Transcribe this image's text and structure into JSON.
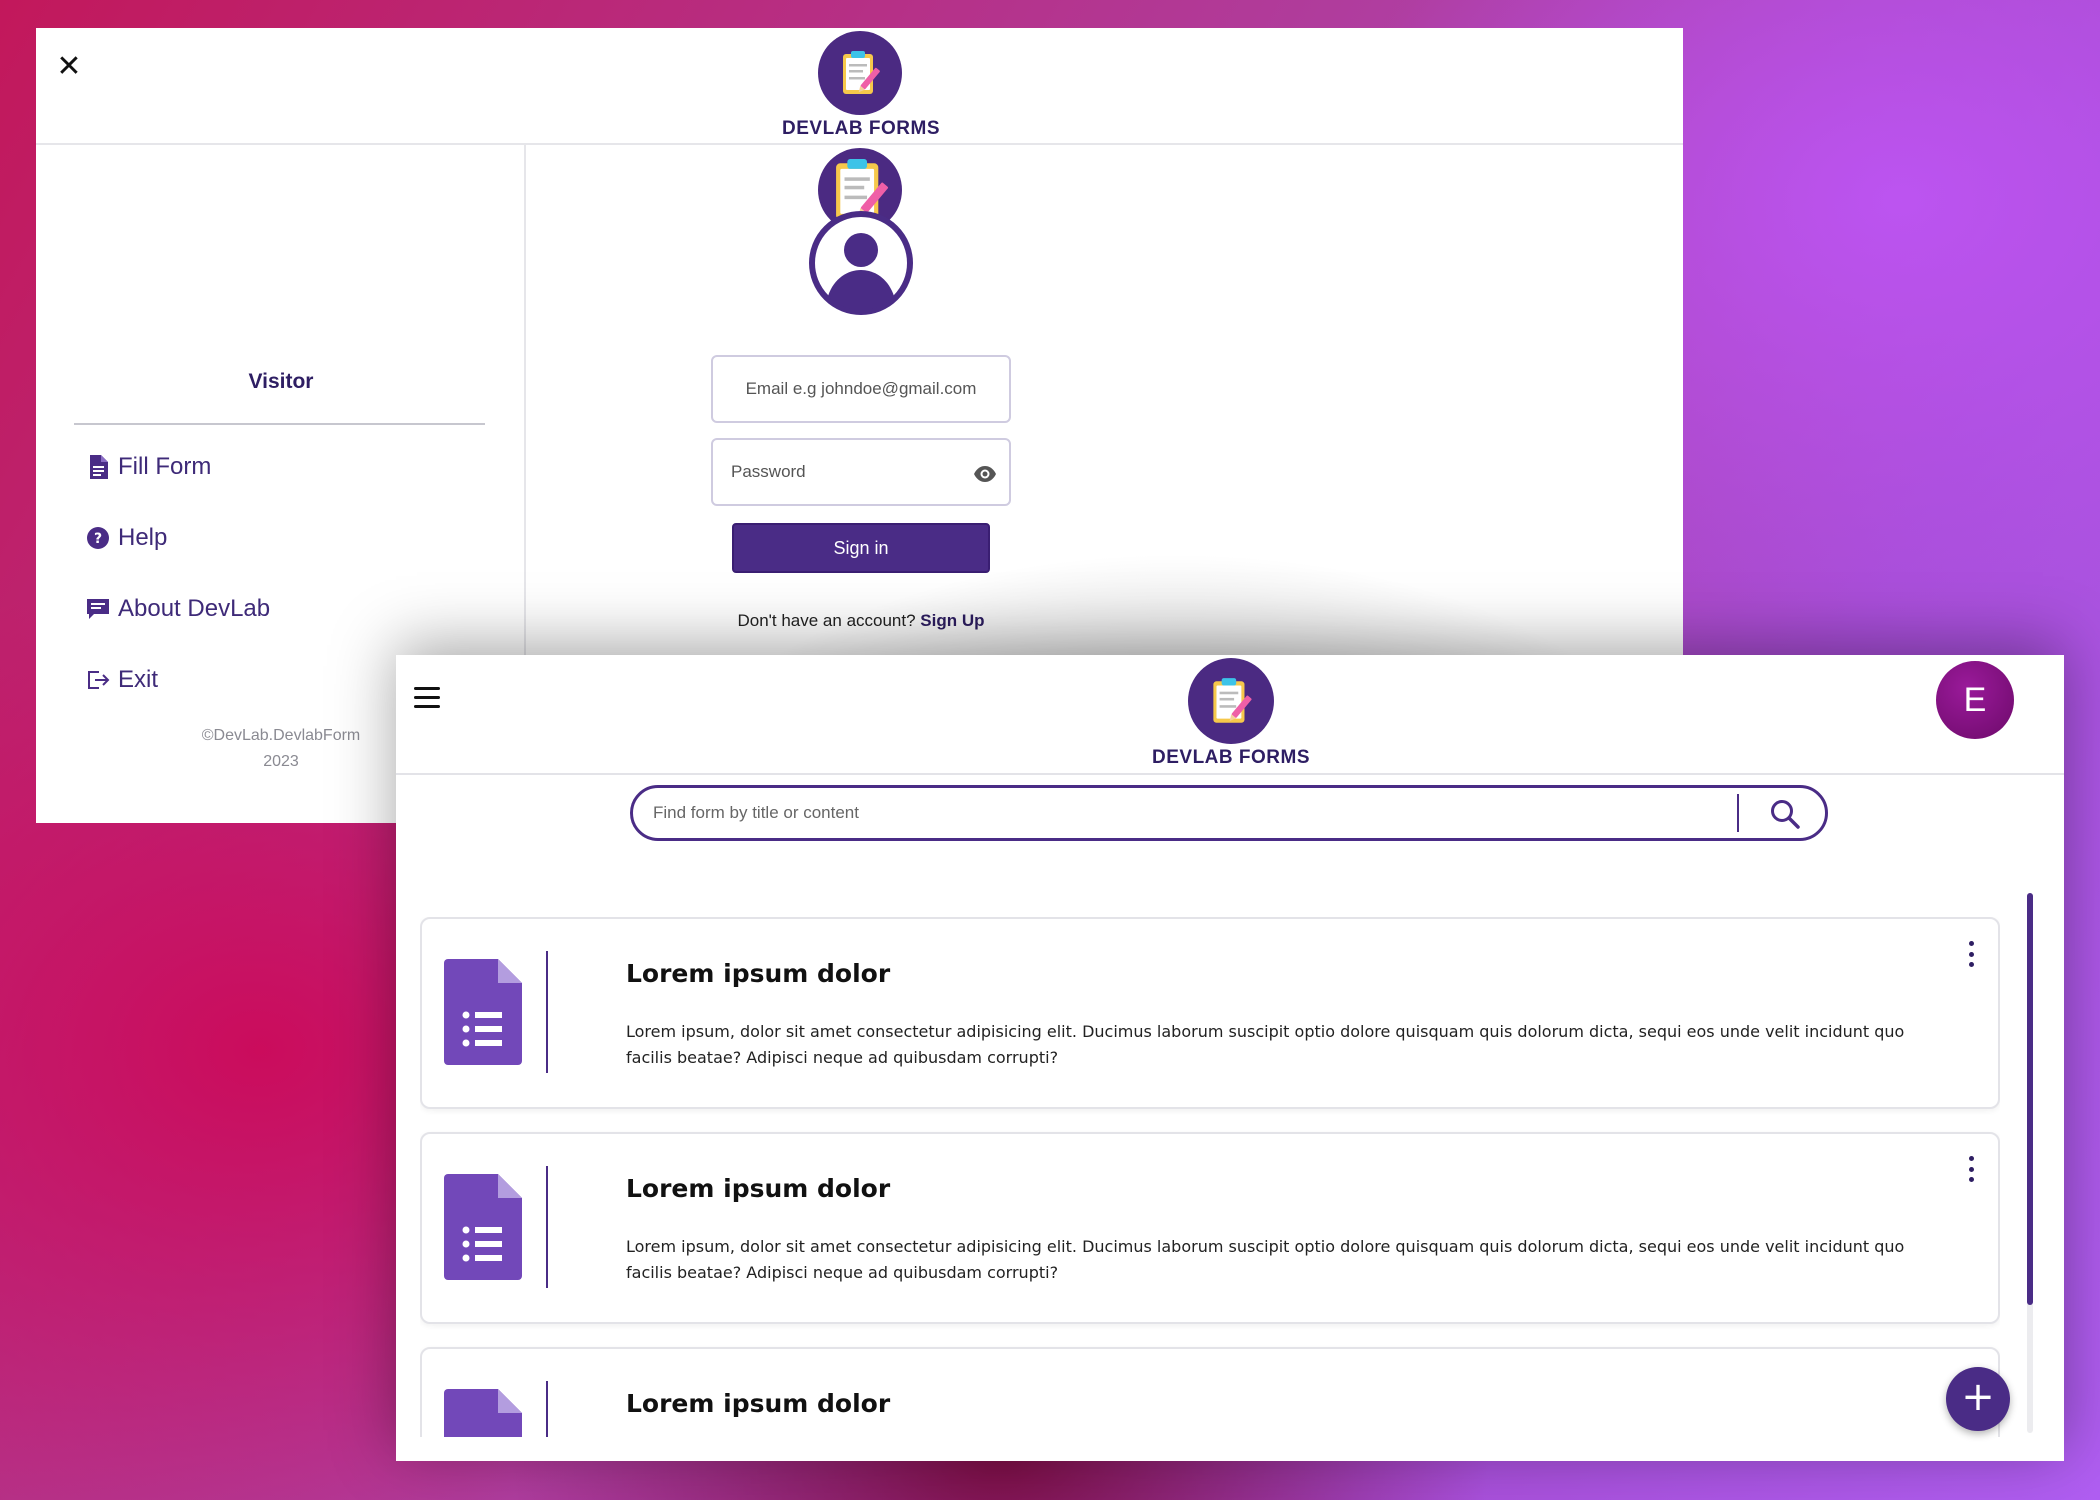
{
  "app": {
    "brand_name": "DEVLAB FORMS"
  },
  "login_window": {
    "close_icon": "close-icon",
    "sidebar": {
      "user_label": "Visitor",
      "menu": [
        {
          "label": "Fill Form",
          "icon": "document-icon"
        },
        {
          "label": "Help",
          "icon": "help-icon"
        },
        {
          "label": "About DevLab",
          "icon": "comment-icon"
        },
        {
          "label": "Exit",
          "icon": "exit-icon"
        }
      ],
      "copyright_line1": "©DevLab.DevlabForm",
      "copyright_line2": "2023"
    },
    "login": {
      "email_placeholder": "Email e.g johndoe@gmail.com",
      "password_placeholder": "Password",
      "signin_label": "Sign in",
      "no_account_text": "Don't have an account? ",
      "signup_label": "Sign Up"
    }
  },
  "forms_window": {
    "user_initial": "E",
    "search": {
      "placeholder": "Find form by title or content"
    },
    "cards": [
      {
        "title": "Lorem ipsum dolor",
        "description": "Lorem ipsum, dolor sit amet consectetur adipisicing elit. Ducimus laborum suscipit optio dolore quisquam quis dolorum dicta, sequi eos unde velit incidunt quo facilis beatae? Adipisci neque ad quibusdam corrupti?"
      },
      {
        "title": "Lorem ipsum dolor",
        "description": "Lorem ipsum, dolor sit amet consectetur adipisicing elit. Ducimus laborum suscipit optio dolore quisquam quis dolorum dicta, sequi eos unde velit incidunt quo facilis beatae? Adipisci neque ad quibusdam corrupti?"
      },
      {
        "title": "Lorem ipsum dolor",
        "description": ""
      }
    ],
    "fab_label": "+"
  },
  "colors": {
    "primary": "#4a2c86",
    "brand_text": "#2e1e63",
    "avatar": "#7a0c78",
    "form_icon": "#7248b9"
  }
}
